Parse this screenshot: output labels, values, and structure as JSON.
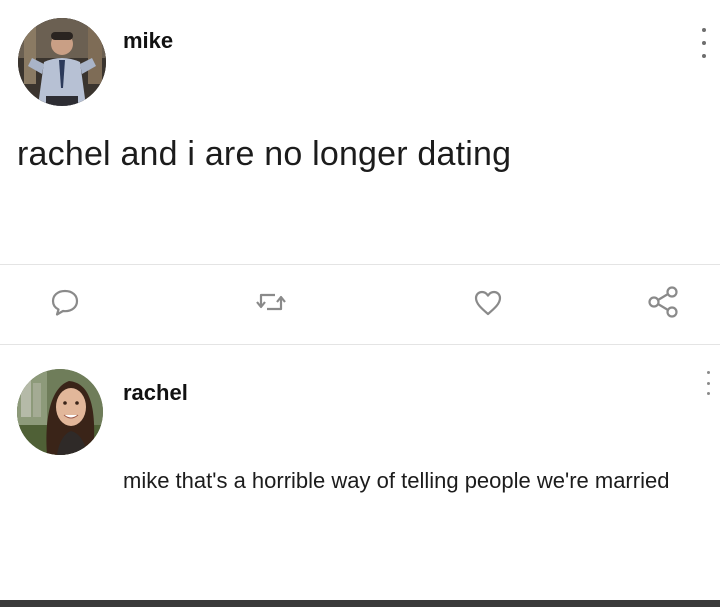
{
  "post": {
    "author": "mike",
    "text": "rachel and i are no longer dating",
    "actions": [
      {
        "icon": "comment-icon"
      },
      {
        "icon": "retweet-icon"
      },
      {
        "icon": "heart-icon"
      },
      {
        "icon": "share-icon"
      }
    ]
  },
  "reply": {
    "author": "rachel",
    "text": "mike that's a horrible way of telling people we're married"
  },
  "colors": {
    "icon": "#8a8a8a",
    "text": "#1c1c1c",
    "divider": "#e4e4e4"
  }
}
